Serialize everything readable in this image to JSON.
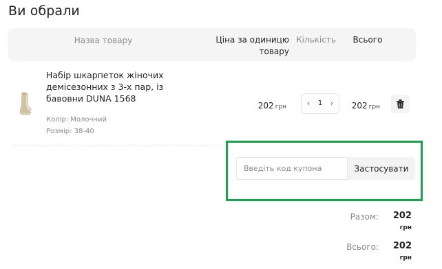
{
  "page": {
    "title": "Ви обрали"
  },
  "table": {
    "headers": {
      "name": "Назва товару",
      "unit_price": "Ціна за одиницю товару",
      "quantity": "Кількість",
      "total": "Всього"
    }
  },
  "item": {
    "name": "Набір шкарпеток жіночих демісезонних з 3-х пар, із бавовни DUNA 1568",
    "color": "Колір: Молочний",
    "size": "Розмір: 38-40",
    "unit_price": "202",
    "quantity": "1",
    "total": "202",
    "currency": "грн",
    "image_icon": "sock-product-icon",
    "delete_icon": "trash-icon"
  },
  "coupon": {
    "placeholder": "Введіть код купона",
    "apply_label": "Застосувати",
    "highlight_color": "#17a34a"
  },
  "summary": {
    "subtotal_label": "Разом:",
    "subtotal_value": "202",
    "total_label": "Всього:",
    "total_value": "202",
    "currency": "грн"
  }
}
